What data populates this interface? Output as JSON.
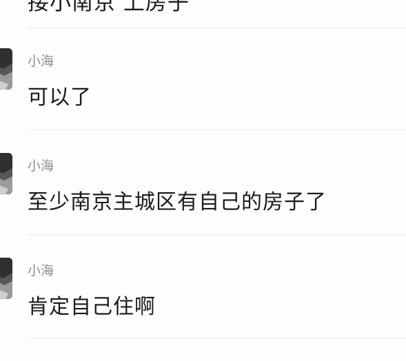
{
  "top_partial_text": "接小南京 上房子",
  "messages": [
    {
      "sender": "小海",
      "text": "可以了"
    },
    {
      "sender": "小海",
      "text": "至少南京主城区有自己的房子了"
    },
    {
      "sender": "小海",
      "text": "肯定自己住啊"
    }
  ]
}
